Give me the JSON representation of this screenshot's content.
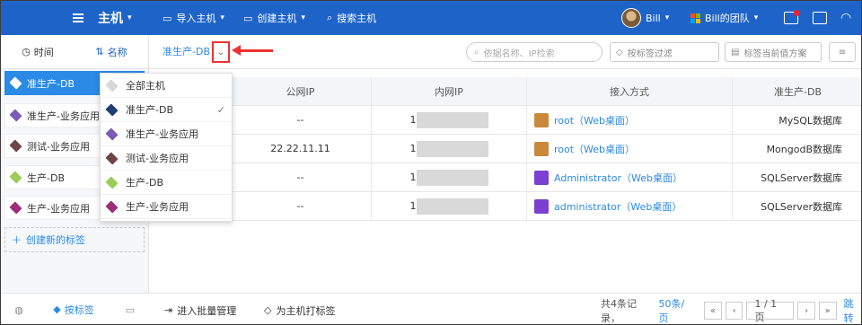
{
  "topbar": {
    "brand": "主机",
    "import_label": "导入主机",
    "create_label": "创建主机",
    "search_label": "搜索主机",
    "user": "Bill",
    "team": "Bill的团队"
  },
  "sort": {
    "time_label": "时间",
    "name_label": "名称"
  },
  "tags": [
    {
      "label": "准生产-DB",
      "color": "#ffffff",
      "selected": true
    },
    {
      "label": "准生产-业务应用",
      "color": "#7a5bb5"
    },
    {
      "label": "测试-业务应用",
      "color": "#6d4545"
    },
    {
      "label": "生产-DB",
      "color": "#9acd5a"
    },
    {
      "label": "生产-业务应用",
      "color": "#9b2f7a"
    }
  ],
  "new_tag_label": "创建新的标签",
  "toolbar": {
    "current_tag": "准生产-DB",
    "search_placeholder": "依据名称、IP检索",
    "tag_filter_placeholder": "按标签过滤",
    "tag_scheme_placeholder": "标签当前值方案"
  },
  "table": {
    "headers": [
      "",
      "公网IP",
      "内网IP",
      "接入方式",
      "准生产-DB"
    ],
    "rows": [
      {
        "public_ip": "--",
        "private_ip": "1",
        "access": "root（Web桌面）",
        "access_color": "#c88a3a",
        "db": "MySQL数据库"
      },
      {
        "public_ip": "22.22.11.11",
        "private_ip": "1",
        "access": "root（Web桌面）",
        "access_color": "#c88a3a",
        "db": "MongodB数据库"
      },
      {
        "public_ip": "--",
        "private_ip": "1",
        "access": "Administrator（Web桌面）",
        "access_color": "#7b3fd1",
        "db": "SQLServer数据库"
      },
      {
        "public_ip": "--",
        "private_ip": "1",
        "access": "administrator（Web桌面）",
        "access_color": "#7b3fd1",
        "db": "SQLServer数据库"
      }
    ]
  },
  "dropdown": {
    "items": [
      {
        "label": "全部主机",
        "color": "#d8d8d8"
      },
      {
        "label": "准生产-DB",
        "color": "#1f3f70",
        "checked": true
      },
      {
        "label": "准生产-业务应用",
        "color": "#7a5bb5"
      },
      {
        "label": "测试-业务应用",
        "color": "#6d4545"
      },
      {
        "label": "生产-DB",
        "color": "#9acd5a"
      },
      {
        "label": "生产-业务应用",
        "color": "#9b2f7a"
      }
    ]
  },
  "bottom": {
    "tab_by_tag": "按标签",
    "batch_label": "进入批量管理",
    "tag_host_label": "为主机打标签",
    "records": "共4条记录，",
    "per_page": "50条/页",
    "page": "1 / 1页",
    "jump": "跳转"
  }
}
